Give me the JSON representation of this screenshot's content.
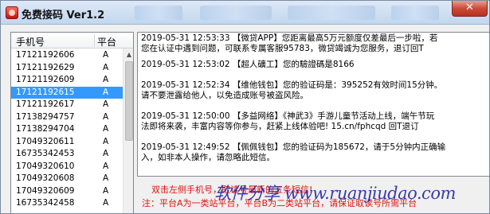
{
  "window": {
    "title": "免费接码 Ver1.2",
    "close_glyph": "✕"
  },
  "phone_list": {
    "header_phone": "手机号",
    "header_platform": "平台",
    "rows": [
      {
        "phone": "17121192606",
        "platform": "A",
        "selected": false
      },
      {
        "phone": "17121192629",
        "platform": "A",
        "selected": false
      },
      {
        "phone": "17121192609",
        "platform": "A",
        "selected": false
      },
      {
        "phone": "17121192615",
        "platform": "A",
        "selected": true
      },
      {
        "phone": "17121192617",
        "platform": "A",
        "selected": false
      },
      {
        "phone": "17138294757",
        "platform": "A",
        "selected": false
      },
      {
        "phone": "17138294704",
        "platform": "A",
        "selected": false
      },
      {
        "phone": "17049320611",
        "platform": "A",
        "selected": false
      },
      {
        "phone": "16735342453",
        "platform": "A",
        "selected": false
      },
      {
        "phone": "17049320610",
        "platform": "A",
        "selected": false
      },
      {
        "phone": "17049320608",
        "platform": "A",
        "selected": false
      },
      {
        "phone": "17049320609",
        "platform": "A",
        "selected": false
      },
      {
        "phone": "16735342458",
        "platform": "A",
        "selected": false
      }
    ]
  },
  "messages": [
    {
      "lines": [
        "2019-05-31 12:53:33 【微贷APP】您距离最高5万元额度仅差最后一步啦，若",
        "您在认证中遇到问题，可联系专属客服95783，微贷竭诚为您服务，退订回T"
      ]
    },
    {
      "lines": [
        "2019-05-31 12:53:02 【超人礦工】您的驗證碼是8166"
      ]
    },
    {
      "lines": [
        "2019-05-31 12:52:34 【维他钱包】您的验证码是：395252有效时间15分钟。",
        "请不要泄露给他人，以免造成账号被盗风险。"
      ]
    },
    {
      "lines": [
        "2019-05-31 12:50:00 【多益网络】《神武3》手游儿童节活动上线，端午节玩",
        "法即将来袭，丰富内容等你参与，赶紧上线体验吧! 15.cn/fphcqd 回T退订"
      ]
    },
    {
      "lines": [
        "2019-05-31 12:49:52 【佩佩钱包】您的验证码为185672，请于5分钟内正确输",
        "入，如非本人操作，请忽略此短信。"
      ]
    }
  ],
  "hints": {
    "line1": "双击左侧手机号，取读号最新的五条短信!",
    "line2": "注：平台A为一类站平台，平台B为二类站平台，请保证取读号所需平台"
  },
  "watermark": "软件分享 www.ruanjiudao.com",
  "colors": {
    "selection": "#3399ff",
    "hint_text": "#e01010"
  }
}
